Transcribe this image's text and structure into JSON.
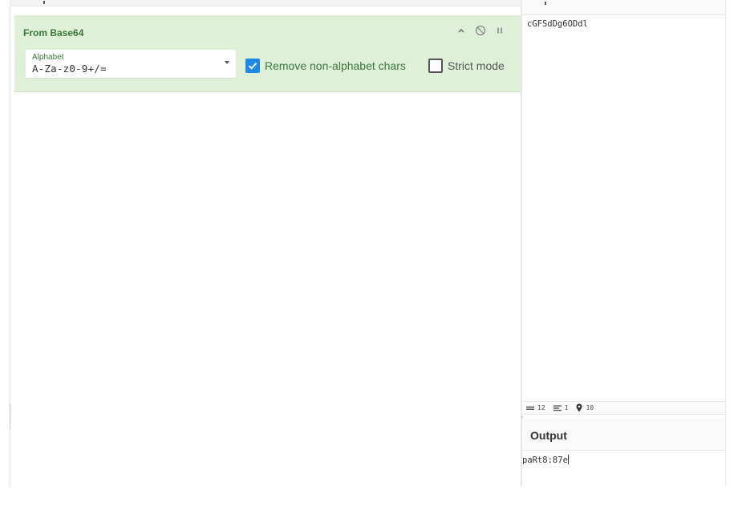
{
  "recipe": {
    "operation": {
      "title": "From Base64",
      "alphabet": {
        "label": "Alphabet",
        "value": "A-Za-z0-9+/="
      },
      "options": [
        {
          "label": "Remove non-alphabet chars",
          "checked": true
        },
        {
          "label": "Strict mode",
          "checked": false
        }
      ],
      "controls": [
        "chevron-up-icon",
        "disable-icon",
        "pause-icon"
      ]
    }
  },
  "input": {
    "text": "cGFSdDg6ODdl"
  },
  "status": {
    "length_icon": "abc-icon",
    "length": "12",
    "lines_icon": "lines-icon",
    "lines": "1",
    "position_icon": "map-pin-icon",
    "position": "10"
  },
  "output": {
    "title": "Output",
    "text": "paRt8:87e"
  },
  "colors": {
    "operation_bg": "#dff0d8",
    "operation_accent": "#3c763d",
    "checkbox_on": "#1e88e5"
  }
}
